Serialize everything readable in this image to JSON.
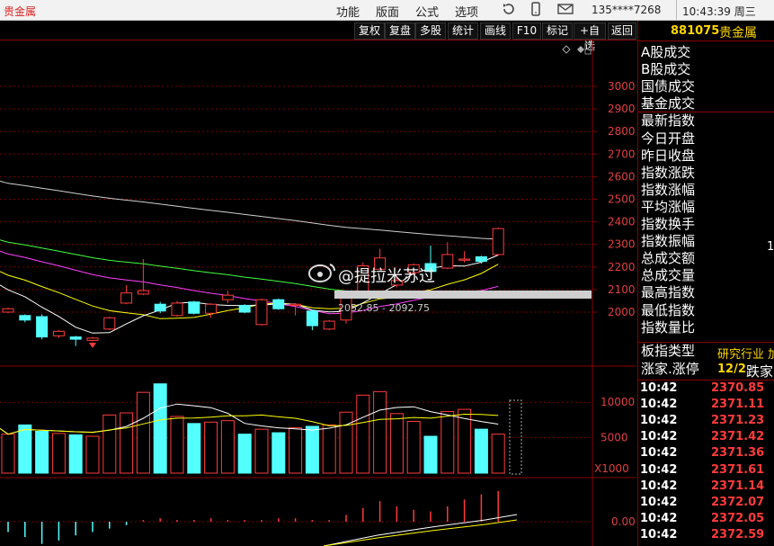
{
  "app": {
    "title": "贵金属"
  },
  "menu": [
    "功能",
    "版面",
    "公式",
    "选项"
  ],
  "account": "135****7268",
  "clock": "10:43:39 周三",
  "toolbar": [
    "复权",
    "复盘",
    "多股",
    "统计",
    "画线",
    "F10",
    "标记",
    "+自选",
    "返回"
  ],
  "security": {
    "code": "881075",
    "name": "贵金属"
  },
  "price_axis": [
    "3000",
    "2900",
    "2800",
    "2700",
    "2600",
    "2500",
    "2400",
    "2300",
    "2200",
    "2100",
    "2000"
  ],
  "volume_axis": [
    "10000",
    "5000"
  ],
  "volume_unit": "X1000",
  "macd_axis": "0.00",
  "range_label": "2052.85 - 2092.75",
  "watermark": "@提拉米苏过",
  "right_labels": [
    "A股成交",
    "B股成交",
    "国债成交",
    "基金成交",
    "最新指数",
    "今日开盘",
    "昨日收盘",
    "指数涨跌",
    "指数涨幅",
    "平均涨幅",
    "指数换手",
    "指数振幅",
    "总成交额",
    "总成交量",
    "最高指数",
    "最低指数",
    "指数量比"
  ],
  "right_partial": "1",
  "board_type": {
    "label": "板指类型",
    "value": "研究行业 加"
  },
  "rise_fall": {
    "label": "涨家.涨停",
    "value": "12/2",
    "tail": "跌家"
  },
  "ticks": [
    {
      "time": "10:42",
      "price": "2370.85"
    },
    {
      "time": "10:42",
      "price": "2371.11"
    },
    {
      "time": "10:42",
      "price": "2371.23"
    },
    {
      "time": "10:42",
      "price": "2371.42"
    },
    {
      "time": "10:42",
      "price": "2371.36"
    },
    {
      "time": "10:42",
      "price": "2371.61"
    },
    {
      "time": "10:42",
      "price": "2371.14"
    },
    {
      "time": "10:42",
      "price": "2372.07"
    },
    {
      "time": "10:42",
      "price": "2372.05"
    },
    {
      "time": "10:42",
      "price": "2372.59"
    }
  ],
  "colors": {
    "up": "#ff3b3b",
    "down": "#54ffff",
    "ma5": "#ffffff",
    "ma10": "#ffff00",
    "ma20": "#ff40ff",
    "ma30": "#40ff40",
    "ma60": "#cfcfcf"
  },
  "candles": [
    {
      "o": 2000,
      "c": 2015,
      "h": 2020,
      "l": 1995
    },
    {
      "o": 1985,
      "c": 1965,
      "h": 1990,
      "l": 1955
    },
    {
      "o": 1980,
      "c": 1890,
      "h": 1990,
      "l": 1880
    },
    {
      "o": 1895,
      "c": 1915,
      "h": 1920,
      "l": 1885
    },
    {
      "o": 1890,
      "c": 1880,
      "h": 1895,
      "l": 1850
    },
    {
      "o": 1875,
      "c": 1885,
      "h": 1890,
      "l": 1870
    },
    {
      "o": 1925,
      "c": 1975,
      "h": 1980,
      "l": 1920
    },
    {
      "o": 2040,
      "c": 2085,
      "h": 2120,
      "l": 2035
    },
    {
      "o": 2080,
      "c": 2095,
      "h": 2235,
      "l": 2075
    },
    {
      "o": 2035,
      "c": 2005,
      "h": 2045,
      "l": 1995
    },
    {
      "o": 1985,
      "c": 2040,
      "h": 2050,
      "l": 1980
    },
    {
      "o": 2045,
      "c": 1995,
      "h": 2050,
      "l": 1990
    },
    {
      "o": 1995,
      "c": 2035,
      "h": 2040,
      "l": 1975
    },
    {
      "o": 2055,
      "c": 2075,
      "h": 2095,
      "l": 2040
    },
    {
      "o": 2030,
      "c": 2000,
      "h": 2035,
      "l": 1995
    },
    {
      "o": 1945,
      "c": 2055,
      "h": 2060,
      "l": 1940
    },
    {
      "o": 2055,
      "c": 2015,
      "h": 2060,
      "l": 2010
    },
    {
      "o": 2030,
      "c": 2035,
      "h": 2040,
      "l": 1985
    },
    {
      "o": 2005,
      "c": 1940,
      "h": 2010,
      "l": 1920
    },
    {
      "o": 1925,
      "c": 1960,
      "h": 1965,
      "l": 1920
    },
    {
      "o": 1965,
      "c": 2065,
      "h": 2070,
      "l": 1950
    },
    {
      "o": 2065,
      "c": 2205,
      "h": 2220,
      "l": 2060
    },
    {
      "o": 2190,
      "c": 2240,
      "h": 2280,
      "l": 2185
    },
    {
      "o": 2120,
      "c": 2140,
      "h": 2160,
      "l": 2110
    },
    {
      "o": 2175,
      "c": 2210,
      "h": 2215,
      "l": 2170
    },
    {
      "o": 2215,
      "c": 2180,
      "h": 2295,
      "l": 2175
    },
    {
      "o": 2195,
      "c": 2255,
      "h": 2310,
      "l": 2190
    },
    {
      "o": 2230,
      "c": 2235,
      "h": 2270,
      "l": 2220
    },
    {
      "o": 2245,
      "c": 2225,
      "h": 2250,
      "l": 2215
    },
    {
      "o": 2255,
      "c": 2370,
      "h": 2375,
      "l": 2250
    }
  ],
  "volumes": [
    5500,
    6800,
    5900,
    5600,
    5400,
    5200,
    8200,
    8500,
    11400,
    12600,
    8000,
    7000,
    7200,
    7400,
    5500,
    6200,
    5700,
    6400,
    6600,
    6800,
    8600,
    11000,
    11500,
    8400,
    7300,
    5200,
    8700,
    9000,
    6200,
    5500,
    5200
  ]
}
